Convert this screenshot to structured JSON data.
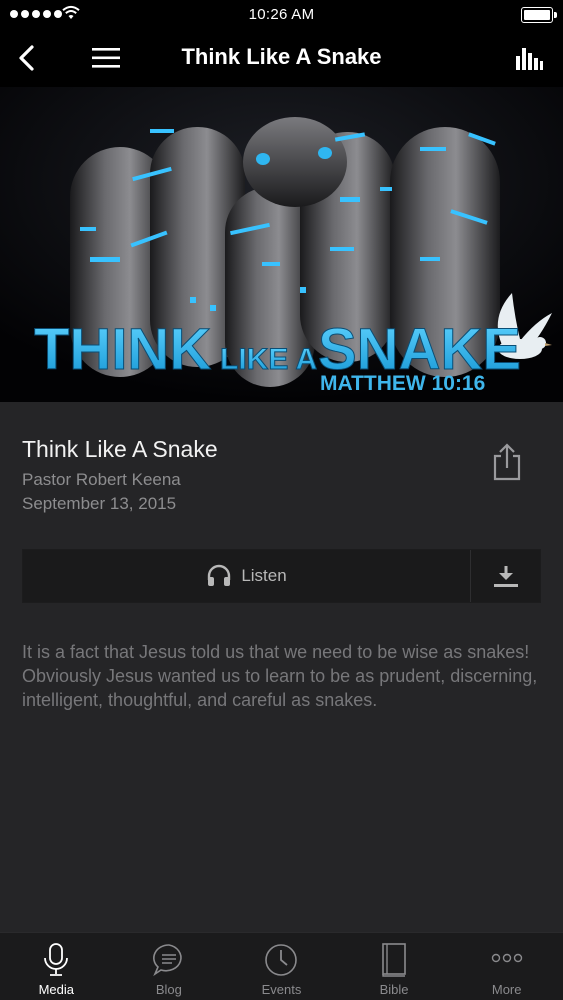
{
  "status_bar": {
    "time": "10:26 AM",
    "signal_bars": 5,
    "battery_level": 1.0
  },
  "nav": {
    "title": "Think Like A Snake",
    "back_icon": "chevron-left-icon",
    "menu_icon": "hamburger-menu-icon",
    "stats_icon": "bar-chart-icon"
  },
  "hero": {
    "line1": "THINK",
    "line2": "LIKE A",
    "line3": "SNAKE",
    "reference": "MATTHEW 10:16",
    "accent_color": "#2fb6f0"
  },
  "sermon": {
    "title": "Think Like A Snake",
    "speaker": "Pastor Robert Keena",
    "date": "September 13, 2015",
    "share_icon": "share-icon"
  },
  "actions": {
    "listen_label": "Listen",
    "listen_icon": "headphones-icon",
    "download_icon": "download-icon"
  },
  "description": {
    "paragraph1": "It is a fact that Jesus told us that we need to be wise as snakes!",
    "paragraph2": "Obviously Jesus wanted us to learn to be as prudent, discerning, intelligent, thoughtful, and careful as snakes."
  },
  "tabs": [
    {
      "label": "Media",
      "icon": "microphone-icon",
      "active": true
    },
    {
      "label": "Blog",
      "icon": "chat-bubble-icon",
      "active": false
    },
    {
      "label": "Events",
      "icon": "clock-icon",
      "active": false
    },
    {
      "label": "Bible",
      "icon": "book-icon",
      "active": false
    },
    {
      "label": "More",
      "icon": "more-dots-icon",
      "active": false
    }
  ]
}
